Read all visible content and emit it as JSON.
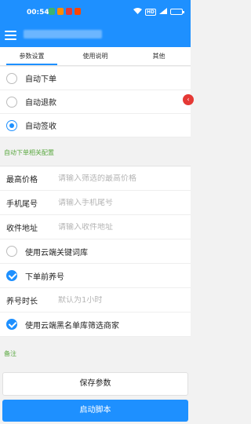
{
  "status_bar": {
    "time": "00:54",
    "network_badge": "HD",
    "notification_colors": [
      "#3cb371",
      "#ff8c00",
      "#e53935",
      "#ff4500"
    ]
  },
  "app_bar": {
    "menu_icon": "hamburger-icon"
  },
  "tabs": [
    {
      "label": "参数设置",
      "active": true
    },
    {
      "label": "使用说明",
      "active": false
    },
    {
      "label": "其他",
      "active": false
    }
  ],
  "modes": [
    {
      "label": "自动下单",
      "selected": false
    },
    {
      "label": "自动退款",
      "selected": false
    },
    {
      "label": "自动签收",
      "selected": true
    }
  ],
  "order_section": {
    "title": "自动下单相关配置"
  },
  "form": {
    "max_price": {
      "label": "最高价格",
      "placeholder": "请输入筛选的最高价格"
    },
    "phone_tail": {
      "label": "手机尾号",
      "placeholder": "请输入手机尾号"
    },
    "address": {
      "label": "收件地址",
      "placeholder": "请输入收件地址"
    },
    "cloud_keywords": {
      "label": "使用云端关键词库",
      "checked": false
    },
    "nurture_before": {
      "label": "下单前养号",
      "checked": true
    },
    "nurture_duration": {
      "label": "养号时长",
      "placeholder": "默认为1小时"
    },
    "cloud_blacklist": {
      "label": "使用云端黑名单库筛选商家",
      "checked": true
    }
  },
  "notes": {
    "title": "备注"
  },
  "buttons": {
    "save": "保存参数",
    "start": "启动脚本"
  },
  "colors": {
    "primary": "#1e90ff",
    "section_text": "#5aa840"
  }
}
